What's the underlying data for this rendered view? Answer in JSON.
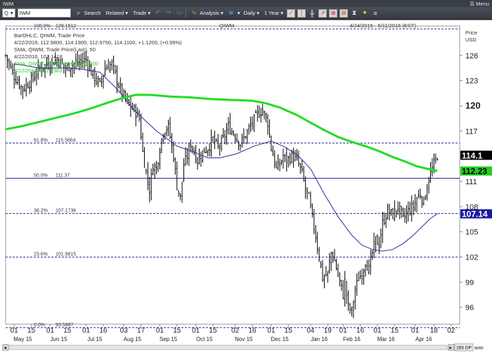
{
  "window": {
    "title": "IWM",
    "menu_label": "Menu"
  },
  "toolbar": {
    "symbol_type": "Q",
    "symbol_value": "IWM",
    "search_label": "Search",
    "related_label": "Related",
    "trade_label": "Trade",
    "analysis_label": "Analysis",
    "period_label": "Daily",
    "range_label": "1 Year"
  },
  "chart_header": {
    "symbol_center": "QIWM",
    "date_range": "4/24/2015 - 5/11/2016 (EST)",
    "legend_lines": [
      {
        "text": "BarOHLC, QIWM, Trade Price",
        "color": "#333333"
      },
      {
        "text": "4/22/2016, 112.9800, 114.1900, 112.9750, 114.1100, +1.1200, (+0.99%)",
        "color": "#333333"
      },
      {
        "text": "SMA, QIWM, Trade Price(Last), 50",
        "color": "#333333"
      },
      {
        "text": "4/22/2016, 107.1418",
        "color": "#333333"
      },
      {
        "text": "SMA, QIWM, Trade Price(Last), 200",
        "color": "#22cc22"
      },
      {
        "text": "4/22/2016, 112.2383",
        "color": "#22cc22"
      }
    ]
  },
  "chart_data": {
    "type": "ohlc",
    "y_axis": {
      "label_top": "Price",
      "label_units": "USD",
      "min": 94,
      "max": 129.5,
      "ticks": [
        96,
        99,
        102,
        105,
        108,
        111,
        117,
        120,
        123,
        126
      ],
      "bold_tick": 120
    },
    "x_axis": {
      "day_ticks": [
        {
          "label": "01",
          "month": "May",
          "d": 5
        },
        {
          "label": "15",
          "month": "May",
          "d": 15
        },
        {
          "label": "01",
          "month": "Jun",
          "d": 26
        },
        {
          "label": "15",
          "month": "Jun",
          "d": 36
        },
        {
          "label": "01",
          "month": "Jul",
          "d": 47
        },
        {
          "label": "16",
          "month": "Jul",
          "d": 57
        },
        {
          "label": "03",
          "month": "Aug",
          "d": 69
        },
        {
          "label": "17",
          "month": "Aug",
          "d": 79
        },
        {
          "label": "01",
          "month": "Sep",
          "d": 90
        },
        {
          "label": "15",
          "month": "Sep",
          "d": 100
        },
        {
          "label": "01",
          "month": "Oct",
          "d": 111
        },
        {
          "label": "15",
          "month": "Oct",
          "d": 121
        },
        {
          "label": "02",
          "month": "Nov",
          "d": 134
        },
        {
          "label": "16",
          "month": "Nov",
          "d": 144
        },
        {
          "label": "01",
          "month": "Dec",
          "d": 155
        },
        {
          "label": "15",
          "month": "Dec",
          "d": 165
        },
        {
          "label": "04",
          "month": "Jan",
          "d": 178
        },
        {
          "label": "19",
          "month": "Jan",
          "d": 188
        },
        {
          "label": "01",
          "month": "Feb",
          "d": 197
        },
        {
          "label": "16",
          "month": "Feb",
          "d": 207
        },
        {
          "label": "01",
          "month": "Mar",
          "d": 217
        },
        {
          "label": "15",
          "month": "Mar",
          "d": 227
        },
        {
          "label": "01",
          "month": "Apr",
          "d": 239
        },
        {
          "label": "18",
          "month": "Apr",
          "d": 250
        },
        {
          "label": "02",
          "month": "May",
          "d": 260
        }
      ],
      "month_labels": [
        {
          "label": "May 15",
          "d": 10
        },
        {
          "label": "Jun 15",
          "d": 31
        },
        {
          "label": "Jul 15",
          "d": 52
        },
        {
          "label": "Aug 15",
          "d": 74
        },
        {
          "label": "Sep 15",
          "d": 95
        },
        {
          "label": "Oct 15",
          "d": 116
        },
        {
          "label": "Nov 15",
          "d": 139
        },
        {
          "label": "Dec 15",
          "d": 160
        },
        {
          "label": "Jan 16",
          "d": 183
        },
        {
          "label": "Feb 16",
          "d": 202
        },
        {
          "label": "Mar 16",
          "d": 222
        },
        {
          "label": "Apr 16",
          "d": 244
        }
      ],
      "min": 0,
      "max": 265
    },
    "fibonacci": [
      {
        "pct": "100.0%",
        "price": "129.1512",
        "value": 129.1512
      },
      {
        "pct": "61.8%",
        "price": "115.5664",
        "value": 115.5664
      },
      {
        "pct": "50.0%",
        "price": "111.37",
        "value": 111.37
      },
      {
        "pct": "38.2%",
        "price": "107.1736",
        "value": 107.1736
      },
      {
        "pct": "23.6%",
        "price": "101.9815",
        "value": 101.9815
      },
      {
        "pct": "0.0%",
        "price": "93.5887",
        "value": 93.5887
      }
    ],
    "price_path": [
      [
        0,
        126
      ],
      [
        5,
        123.5
      ],
      [
        10,
        122
      ],
      [
        15,
        123
      ],
      [
        20,
        124.5
      ],
      [
        25,
        125
      ],
      [
        30,
        125.5
      ],
      [
        35,
        124.5
      ],
      [
        40,
        125
      ],
      [
        47,
        125.5
      ],
      [
        50,
        124
      ],
      [
        55,
        122.5
      ],
      [
        58,
        124.5
      ],
      [
        62,
        125
      ],
      [
        65,
        123
      ],
      [
        68,
        121.5
      ],
      [
        72,
        120
      ],
      [
        75,
        119.5
      ],
      [
        78,
        118.5
      ],
      [
        80,
        114.5
      ],
      [
        82,
        112
      ],
      [
        84,
        110
      ],
      [
        86,
        113
      ],
      [
        88,
        112.5
      ],
      [
        90,
        115
      ],
      [
        92,
        117
      ],
      [
        95,
        117.5
      ],
      [
        98,
        114
      ],
      [
        100,
        110.5
      ],
      [
        102,
        109
      ],
      [
        104,
        113
      ],
      [
        106,
        114
      ],
      [
        108,
        115.5
      ],
      [
        110,
        114.5
      ],
      [
        112,
        113.5
      ],
      [
        115,
        114.5
      ],
      [
        118,
        115
      ],
      [
        121,
        116
      ],
      [
        124,
        115
      ],
      [
        127,
        116
      ],
      [
        130,
        117.5
      ],
      [
        134,
        116.5
      ],
      [
        137,
        115.5
      ],
      [
        140,
        116.5
      ],
      [
        144,
        118
      ],
      [
        147,
        119
      ],
      [
        150,
        119.5
      ],
      [
        153,
        118
      ],
      [
        155,
        115
      ],
      [
        158,
        112.5
      ],
      [
        160,
        113
      ],
      [
        162,
        114
      ],
      [
        164,
        113.5
      ],
      [
        167,
        114
      ],
      [
        170,
        113.5
      ],
      [
        173,
        112
      ],
      [
        175,
        110
      ],
      [
        177,
        109
      ],
      [
        179,
        106.5
      ],
      [
        181,
        104.5
      ],
      [
        183,
        102
      ],
      [
        185,
        99.5
      ],
      [
        188,
        100
      ],
      [
        190,
        102.5
      ],
      [
        192,
        101.5
      ],
      [
        195,
        99
      ],
      [
        197,
        97.5
      ],
      [
        198,
        99
      ],
      [
        200,
        96
      ],
      [
        202,
        95.5
      ],
      [
        204,
        98
      ],
      [
        206,
        99.5
      ],
      [
        208,
        100
      ],
      [
        210,
        101.5
      ],
      [
        212,
        100.5
      ],
      [
        214,
        102.5
      ],
      [
        216,
        104
      ],
      [
        218,
        103.5
      ],
      [
        220,
        106
      ],
      [
        223,
        107.5
      ],
      [
        226,
        107
      ],
      [
        229,
        108
      ],
      [
        232,
        106.5
      ],
      [
        235,
        107.5
      ],
      [
        238,
        108
      ],
      [
        240,
        109
      ],
      [
        242,
        109.5
      ],
      [
        244,
        108.5
      ],
      [
        246,
        110.5
      ],
      [
        248,
        112
      ],
      [
        250,
        113
      ],
      [
        252,
        114.1
      ]
    ],
    "sma50_path": [
      [
        5,
        125
      ],
      [
        20,
        124.5
      ],
      [
        40,
        124.5
      ],
      [
        55,
        124
      ],
      [
        65,
        122
      ],
      [
        75,
        119.5
      ],
      [
        88,
        117
      ],
      [
        100,
        115.2
      ],
      [
        110,
        114.5
      ],
      [
        118,
        113.8
      ],
      [
        125,
        113.8
      ],
      [
        135,
        114.3
      ],
      [
        145,
        115.2
      ],
      [
        155,
        115.8
      ],
      [
        162,
        115.2
      ],
      [
        170,
        114.2
      ],
      [
        178,
        112.5
      ],
      [
        186,
        109.5
      ],
      [
        194,
        106.8
      ],
      [
        202,
        104.6
      ],
      [
        208,
        103.4
      ],
      [
        214,
        102.9
      ],
      [
        220,
        102.7
      ],
      [
        226,
        102.9
      ],
      [
        232,
        103.6
      ],
      [
        238,
        104.6
      ],
      [
        244,
        105.8
      ],
      [
        248,
        106.6
      ],
      [
        252,
        107.14
      ]
    ],
    "sma200_path": [
      [
        0,
        117.2
      ],
      [
        10,
        117.6
      ],
      [
        20,
        118.1
      ],
      [
        30,
        118.6
      ],
      [
        40,
        119.1
      ],
      [
        50,
        119.7
      ],
      [
        60,
        120.4
      ],
      [
        68,
        120.9
      ],
      [
        76,
        121.3
      ],
      [
        84,
        121.3
      ],
      [
        96,
        121.1
      ],
      [
        108,
        121.0
      ],
      [
        120,
        120.8
      ],
      [
        132,
        120.7
      ],
      [
        144,
        120.6
      ],
      [
        152,
        120.3
      ],
      [
        160,
        119.8
      ],
      [
        170,
        118.9
      ],
      [
        178,
        118.0
      ],
      [
        186,
        117.1
      ],
      [
        194,
        116.3
      ],
      [
        202,
        115.7
      ],
      [
        210,
        115.2
      ],
      [
        218,
        114.6
      ],
      [
        226,
        113.9
      ],
      [
        234,
        113.3
      ],
      [
        240,
        112.8
      ],
      [
        246,
        112.5
      ],
      [
        252,
        112.24
      ]
    ],
    "last_labels": [
      {
        "text": "114.1",
        "value": 114.11,
        "bg": "#000000",
        "fg": "#ffffff"
      },
      {
        "text": "112.23",
        "value": 112.24,
        "bg": "#22cc22",
        "fg": "#000000"
      },
      {
        "text": "107.14",
        "value": 107.14,
        "bg": "#1a1aa0",
        "fg": "#ffffff"
      }
    ],
    "colors": {
      "bars": "#000000",
      "sma50": "#2a2a9a",
      "sma200": "#22dd22",
      "fib": "#2a2a9a",
      "axis": "#888888"
    }
  },
  "footer": {
    "zoom_label": "265 DP",
    "auto_label": "auto"
  }
}
